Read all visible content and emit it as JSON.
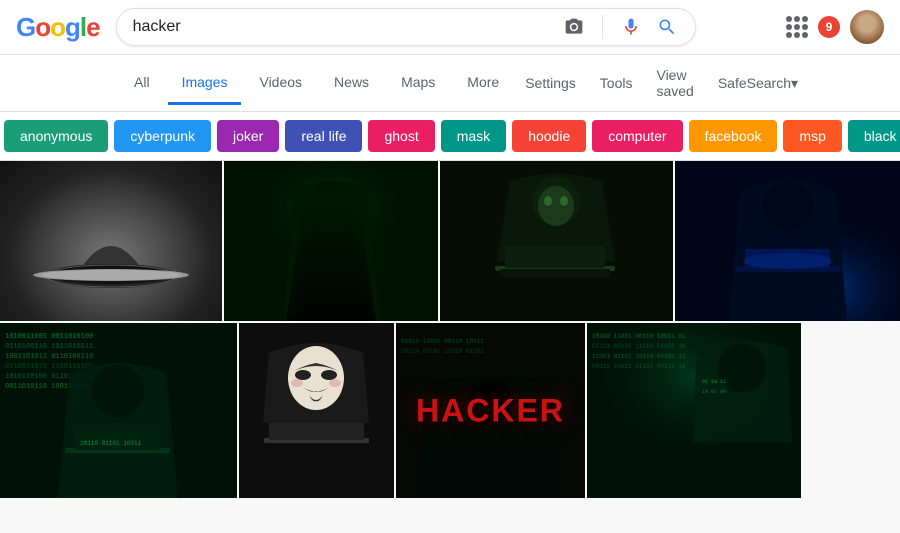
{
  "header": {
    "logo": "Google",
    "search_query": "hacker",
    "camera_icon": "📷",
    "mic_icon": "🎤",
    "search_icon": "🔍",
    "grid_icon": "grid",
    "notification_count": "9",
    "avatar_alt": "user avatar"
  },
  "nav": {
    "tabs": [
      {
        "id": "all",
        "label": "All",
        "active": false
      },
      {
        "id": "images",
        "label": "Images",
        "active": true
      },
      {
        "id": "videos",
        "label": "Videos",
        "active": false
      },
      {
        "id": "news",
        "label": "News",
        "active": false
      },
      {
        "id": "maps",
        "label": "Maps",
        "active": false
      },
      {
        "id": "more",
        "label": "More",
        "active": false
      }
    ],
    "right_items": [
      {
        "id": "settings",
        "label": "Settings"
      },
      {
        "id": "tools",
        "label": "Tools"
      },
      {
        "id": "view_saved",
        "label": "View saved"
      },
      {
        "id": "safesearch",
        "label": "SafeSearch▾"
      }
    ]
  },
  "filters": {
    "chips": [
      {
        "id": "anonymous",
        "label": "anonymous",
        "color": "#1b9e77"
      },
      {
        "id": "cyberpunk",
        "label": "cyberpunk",
        "color": "#2196F3"
      },
      {
        "id": "joker",
        "label": "joker",
        "color": "#9c27b0"
      },
      {
        "id": "real_life",
        "label": "real life",
        "color": "#3f51b5"
      },
      {
        "id": "ghost",
        "label": "ghost",
        "color": "#e91e63"
      },
      {
        "id": "mask",
        "label": "mask",
        "color": "#009688"
      },
      {
        "id": "hoodie",
        "label": "hoodie",
        "color": "#f44336"
      },
      {
        "id": "computer",
        "label": "computer",
        "color": "#e91e63"
      },
      {
        "id": "facebook",
        "label": "facebook",
        "color": "#ff9800"
      },
      {
        "id": "msp",
        "label": "msp",
        "color": "#ff5722"
      },
      {
        "id": "black_hat",
        "label": "black h...",
        "color": "#009688"
      }
    ],
    "arrow_label": "›"
  },
  "images": {
    "row1": [
      {
        "id": "img1",
        "alt": "hacker hat on ground",
        "type": "hat"
      },
      {
        "id": "img2",
        "alt": "hacker in hoodie figure",
        "type": "figure"
      },
      {
        "id": "img3",
        "alt": "hacker with mask at laptop",
        "type": "laptop"
      },
      {
        "id": "img4",
        "alt": "hacker with laptop blue light",
        "type": "blue"
      }
    ],
    "row2": [
      {
        "id": "img5",
        "alt": "hacker with matrix code",
        "type": "matrix"
      },
      {
        "id": "img6",
        "alt": "hacker with mask",
        "type": "mask"
      },
      {
        "id": "img7",
        "alt": "HACKER text",
        "type": "text",
        "label": "HACKER"
      },
      {
        "id": "img8",
        "alt": "digital hacker",
        "type": "digital"
      }
    ]
  }
}
